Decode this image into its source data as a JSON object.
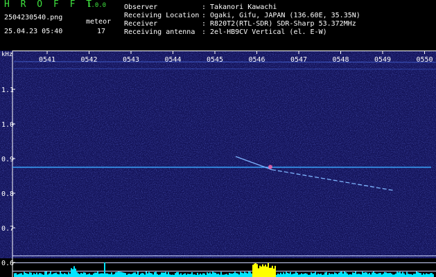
{
  "app": {
    "title": "H R O F F T",
    "version": "1.0.0",
    "file_name": "2504230540.png",
    "meteor_label": "meteor",
    "date_time": "25.04.23 05:40",
    "meteor_count": "17"
  },
  "info": [
    {
      "label": "Observer",
      "value": ": Takanori Kawachi"
    },
    {
      "label": "Receiving Location",
      "value": ": Ogaki, Gifu, JAPAN (136.60E, 35.35N)"
    },
    {
      "label": "Receiver",
      "value": ": R820T2(RTL-SDR) SDR-Sharp 53.372MHz"
    },
    {
      "label": "Receiving antenna",
      "value": ": 2el-HB9CV Vertical (el. E-W)"
    }
  ],
  "axis": {
    "unit": "kHz",
    "time_ticks": [
      "0541",
      "0542",
      "0543",
      "0544",
      "0545",
      "0546",
      "0547",
      "0548",
      "0549",
      "0550"
    ],
    "freq_ticks": [
      "1.1",
      "1.0",
      "0.9",
      "0.8",
      "0.7",
      "0.6"
    ]
  },
  "colors": {
    "background": "#1a1a6e",
    "carrier": "#3aa6ff",
    "meteor": "#7fb6ff",
    "level": "#00e5ff",
    "peak": "#ffff00",
    "text": "#ffffff",
    "title": "#3fe23f"
  }
}
